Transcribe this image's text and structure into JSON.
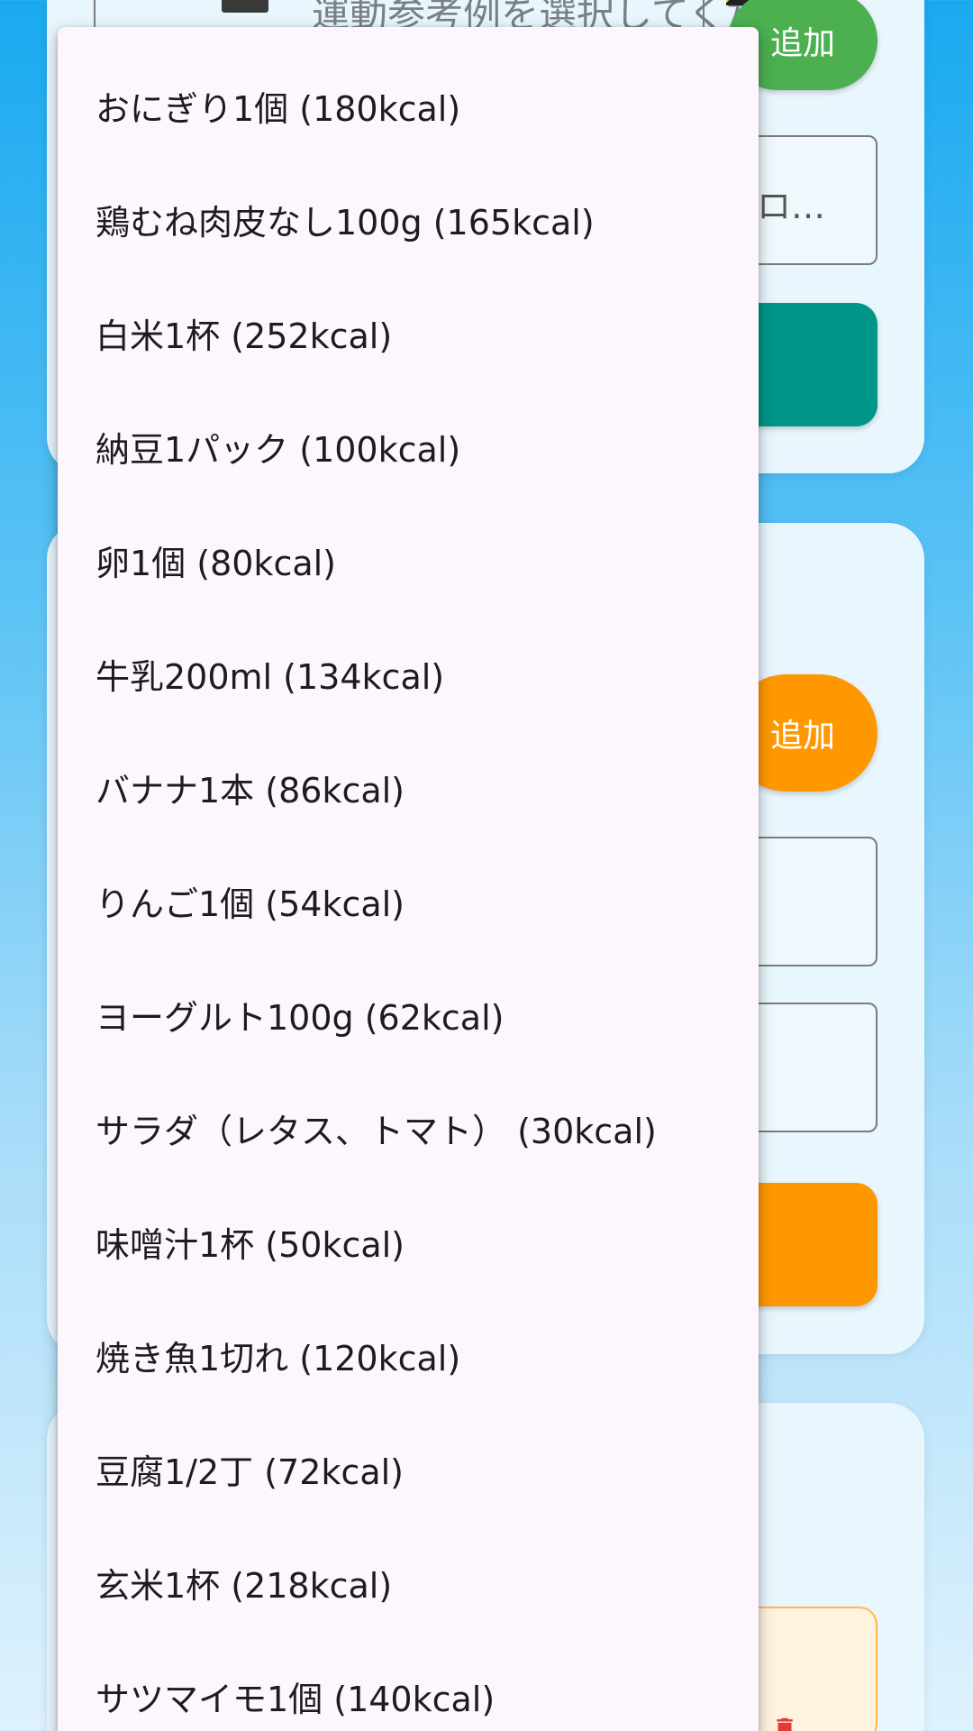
{
  "background": {
    "exercise_select_placeholder": "運動参考例を選択してください",
    "exercise_add_label": "追加",
    "field_partial_text": "ロ…",
    "food_add_label": "追加"
  },
  "dropdown": {
    "items": [
      {
        "label": "おにぎり1個 (180kcal)"
      },
      {
        "label": "鶏むね肉皮なし100g (165kcal)"
      },
      {
        "label": "白米1杯 (252kcal)"
      },
      {
        "label": "納豆1パック (100kcal)"
      },
      {
        "label": "卵1個 (80kcal)"
      },
      {
        "label": "牛乳200ml (134kcal)"
      },
      {
        "label": "バナナ1本 (86kcal)"
      },
      {
        "label": "りんご1個 (54kcal)"
      },
      {
        "label": "ヨーグルト100g (62kcal)"
      },
      {
        "label": "サラダ（レタス、トマト） (30kcal)"
      },
      {
        "label": "味噌汁1杯 (50kcal)"
      },
      {
        "label": "焼き魚1切れ (120kcal)"
      },
      {
        "label": "豆腐1/2丁 (72kcal)"
      },
      {
        "label": "玄米1杯 (218kcal)"
      },
      {
        "label": "サツマイモ1個 (140kcal)"
      }
    ]
  },
  "colors": {
    "green_button": "#4caf50",
    "orange_button": "#ff9800",
    "teal_button": "#009688",
    "trash_icon": "#e53935"
  }
}
